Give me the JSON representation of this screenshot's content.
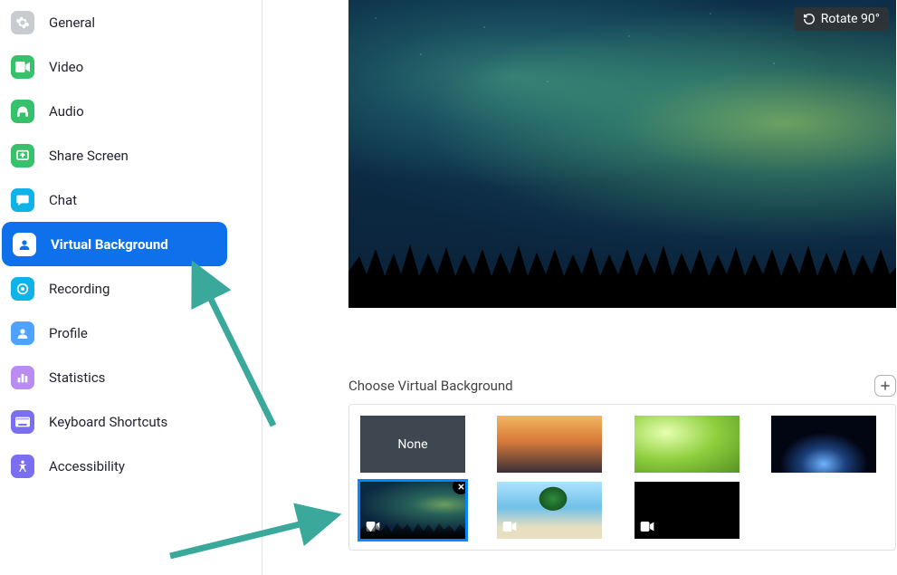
{
  "sidebar": {
    "items": [
      {
        "label": "General",
        "icon": "gear-icon",
        "color": "#c8ccd0",
        "active": false
      },
      {
        "label": "Video",
        "icon": "video-icon",
        "color": "#36c26b",
        "active": false
      },
      {
        "label": "Audio",
        "icon": "headphones-icon",
        "color": "#36c26b",
        "active": false
      },
      {
        "label": "Share Screen",
        "icon": "share-screen-icon",
        "color": "#36c26b",
        "active": false
      },
      {
        "label": "Chat",
        "icon": "chat-icon",
        "color": "#10b3e8",
        "active": false
      },
      {
        "label": "Virtual Background",
        "icon": "virtual-background-icon",
        "color": "#ffffff",
        "active": true
      },
      {
        "label": "Recording",
        "icon": "recording-icon",
        "color": "#10b3e8",
        "active": false
      },
      {
        "label": "Profile",
        "icon": "profile-icon",
        "color": "#4da3ff",
        "active": false
      },
      {
        "label": "Statistics",
        "icon": "statistics-icon",
        "color": "#b98df0",
        "active": false
      },
      {
        "label": "Keyboard Shortcuts",
        "icon": "keyboard-icon",
        "color": "#7a6ff0",
        "active": false
      },
      {
        "label": "Accessibility",
        "icon": "accessibility-icon",
        "color": "#7a6ff0",
        "active": false
      }
    ]
  },
  "preview": {
    "rotate_label": "Rotate 90°"
  },
  "section": {
    "title": "Choose Virtual Background"
  },
  "thumbs": {
    "none_label": "None",
    "items": [
      {
        "kind": "none",
        "selected": false,
        "video": false
      },
      {
        "kind": "bridge",
        "selected": false,
        "video": false
      },
      {
        "kind": "grass",
        "selected": false,
        "video": false
      },
      {
        "kind": "earth",
        "selected": false,
        "video": false
      },
      {
        "kind": "aurora",
        "selected": true,
        "video": true,
        "removable": true
      },
      {
        "kind": "beach",
        "selected": false,
        "video": true
      },
      {
        "kind": "black",
        "selected": false,
        "video": true
      }
    ]
  },
  "annotations": {
    "arrow_color": "#3aa89a"
  }
}
